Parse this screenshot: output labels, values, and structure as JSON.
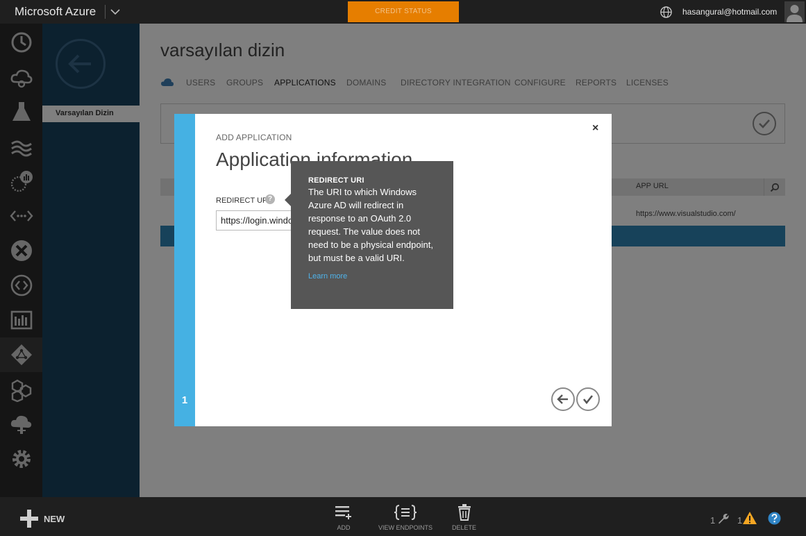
{
  "header": {
    "brand": "Microsoft Azure",
    "credit_status": "CREDIT STATUS",
    "user_email": "hasangural@hotmail.com"
  },
  "nav_panel": {
    "selected_item": "Varsayılan Dizin"
  },
  "page": {
    "title": "varsayılan dizin",
    "tabs": [
      "USERS",
      "GROUPS",
      "APPLICATIONS",
      "DOMAINS",
      "DIRECTORY INTEGRATION",
      "CONFIGURE",
      "REPORTS",
      "LICENSES"
    ],
    "active_tab": "APPLICATIONS",
    "table": {
      "app_url_header": "APP URL",
      "rows": [
        {
          "app_url": "https://www.visualstudio.com/"
        }
      ]
    }
  },
  "dialog": {
    "kicker": "ADD APPLICATION",
    "title": "Application information",
    "field_label": "REDIRECT URI",
    "field_value": "https://login.windows.net",
    "step": "1",
    "close_glyph": "×",
    "help_glyph": "?"
  },
  "tooltip": {
    "title": "REDIRECT URI",
    "body": "The URI to which Windows Azure AD will redirect in response to an OAuth 2.0 request. The value does not need to be a physical endpoint, but must be a valid URI.",
    "link": "Learn more"
  },
  "footer": {
    "new_label": "NEW",
    "commands": [
      "ADD",
      "VIEW ENDPOINTS",
      "DELETE"
    ],
    "status": {
      "tools_count": "1",
      "warnings_count": "1"
    }
  },
  "colors": {
    "accent_blue": "#45b1e3",
    "nav_panel": "#19425f",
    "credit_orange": "#e67e00",
    "selected_row": "#2f84b5"
  },
  "icons": {
    "rail": [
      "recent-icon",
      "cloud-services-icon",
      "lab-icon",
      "hdinsight-icon",
      "analytics-icon",
      "api-icon",
      "connect-icon",
      "remoteapp-icon",
      "dashboard-icon",
      "active-directory-icon",
      "biztalk-icon",
      "cloud-deploy-icon",
      "settings-icon"
    ]
  }
}
